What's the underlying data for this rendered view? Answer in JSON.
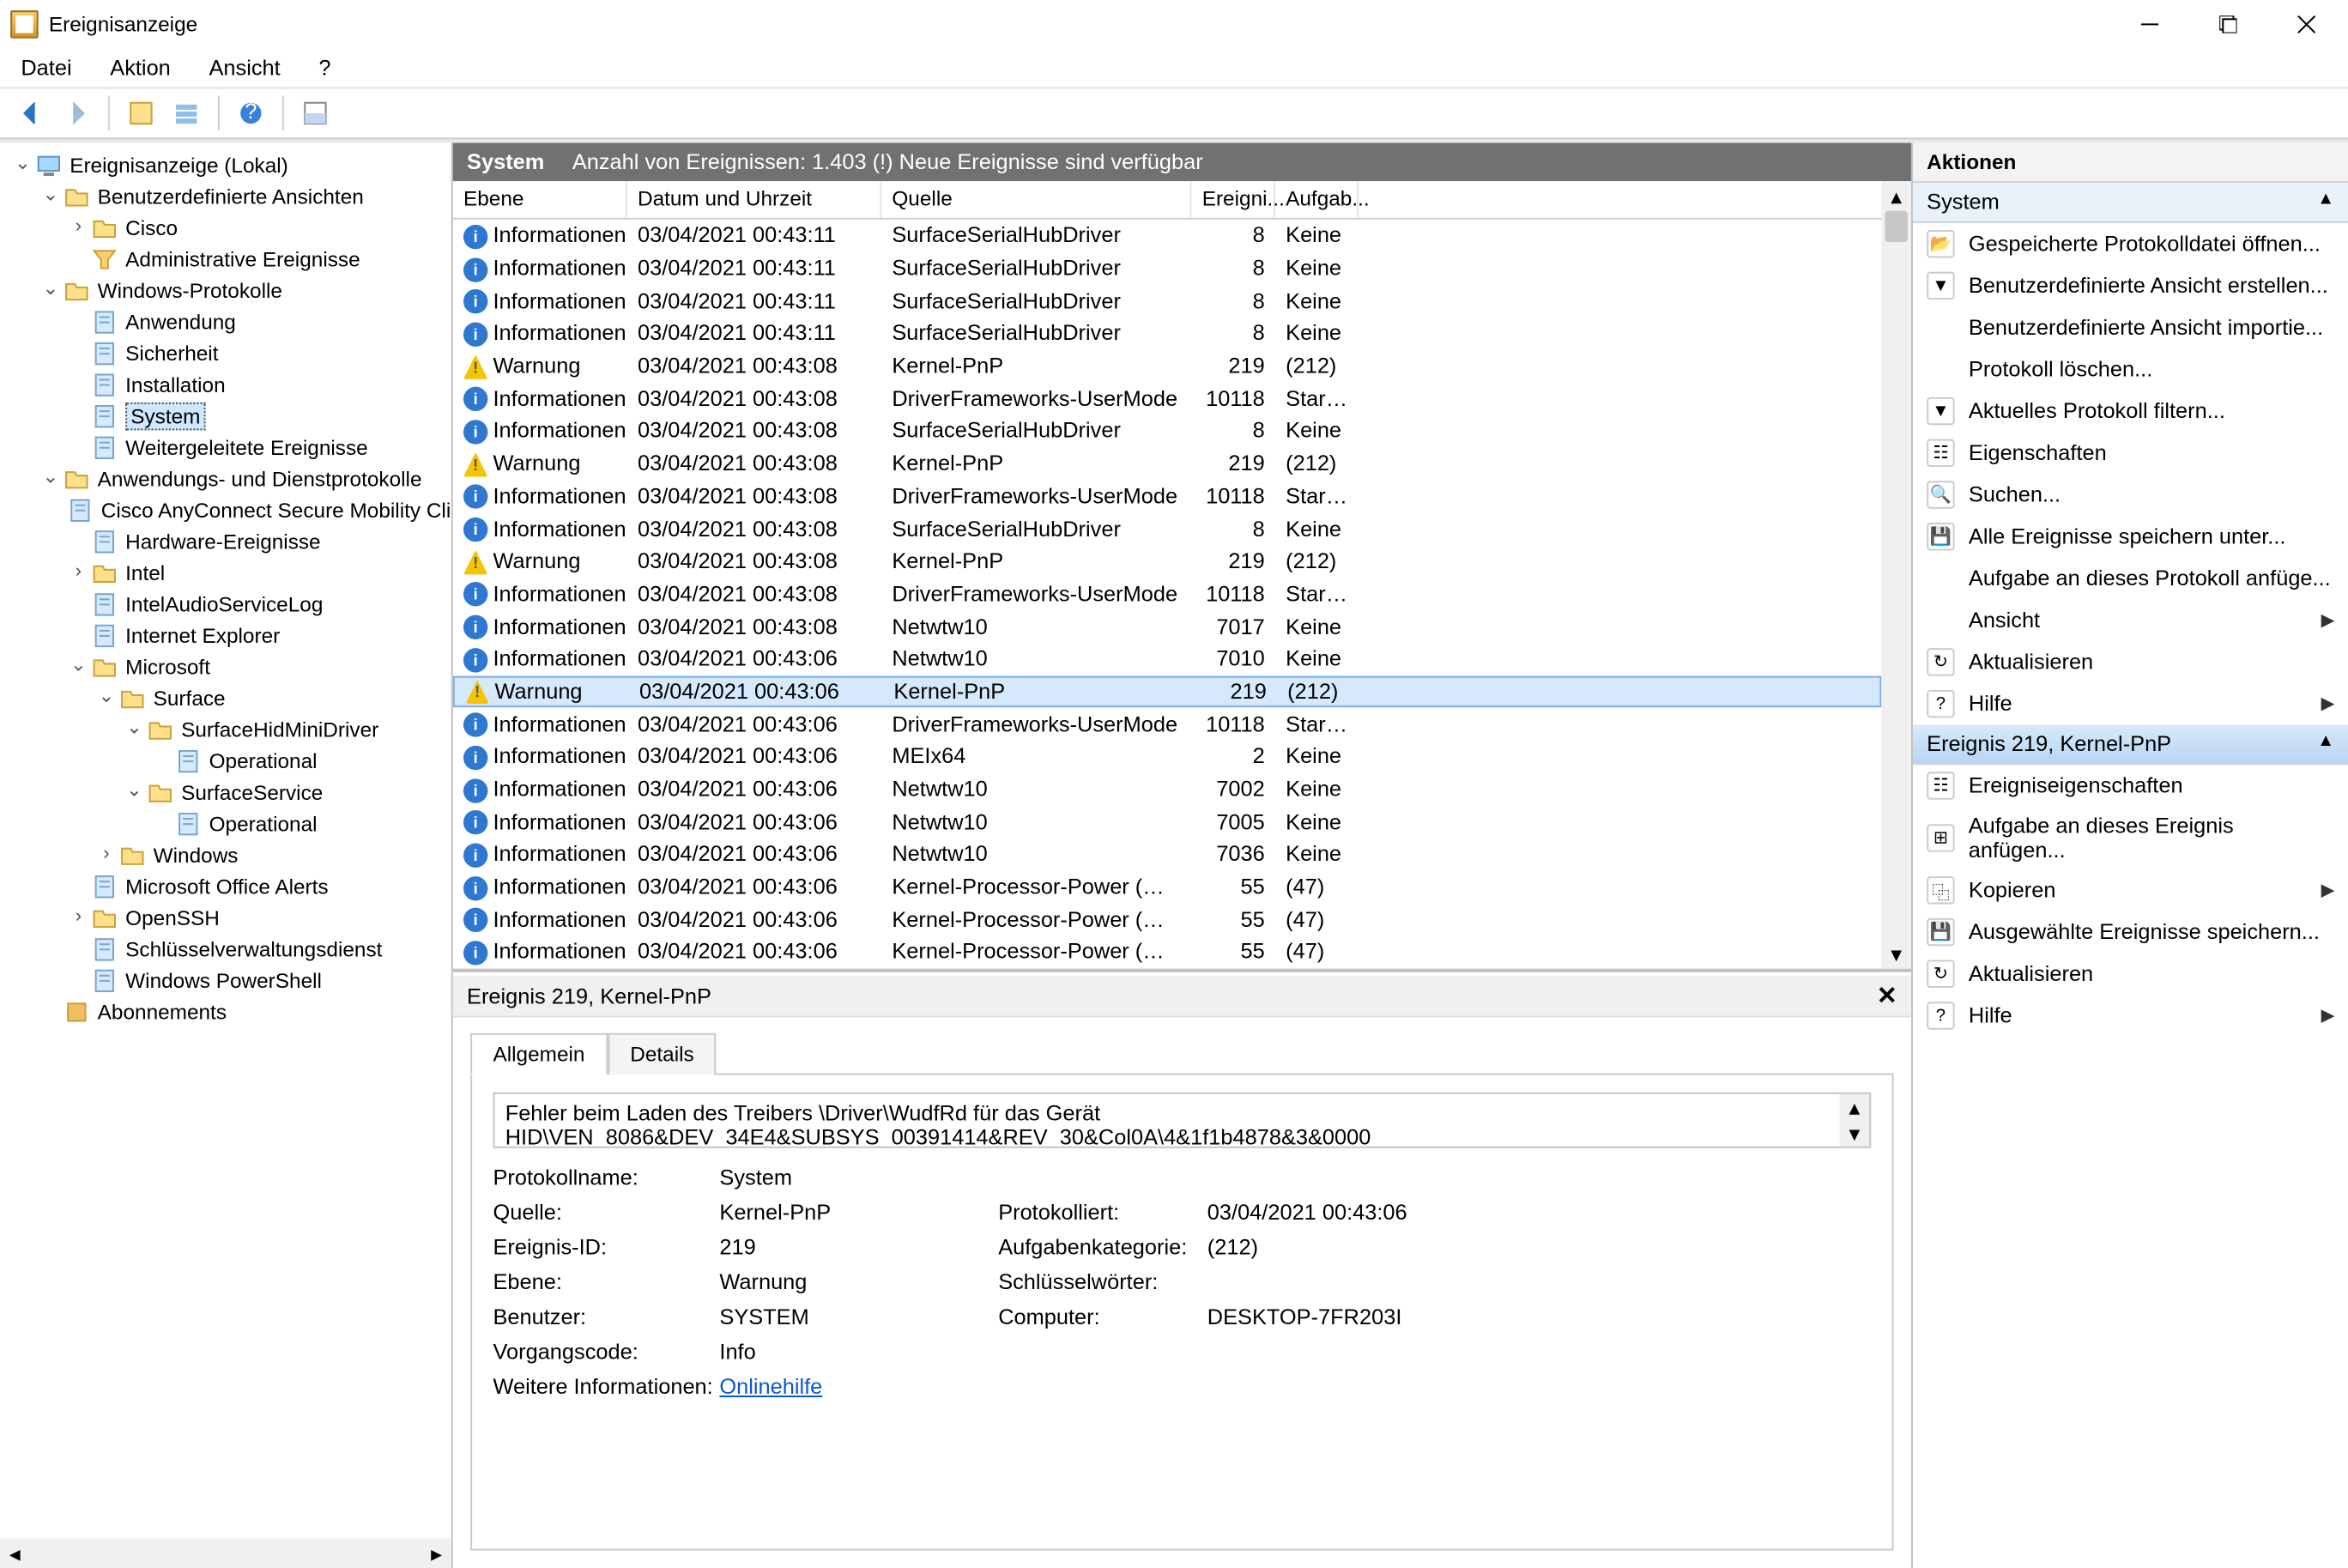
{
  "window": {
    "title": "Ereignisanzeige"
  },
  "menubar": [
    "Datei",
    "Aktion",
    "Ansicht",
    "?"
  ],
  "toolbar_icons": [
    "back-icon",
    "forward-icon",
    "up-level-icon",
    "table-icon",
    "properties-icon",
    "help-icon",
    "preview-icon"
  ],
  "tree": {
    "root": "Ereignisanzeige (Lokal)",
    "items": [
      {
        "depth": 0,
        "tw": "v",
        "icon": "comp",
        "label": "Ereignisanzeige (Lokal)"
      },
      {
        "depth": 1,
        "tw": "v",
        "icon": "folder",
        "label": "Benutzerdefinierte Ansichten"
      },
      {
        "depth": 2,
        "tw": ">",
        "icon": "folder",
        "label": "Cisco"
      },
      {
        "depth": 2,
        "tw": " ",
        "icon": "filter",
        "label": "Administrative Ereignisse"
      },
      {
        "depth": 1,
        "tw": "v",
        "icon": "folder",
        "label": "Windows-Protokolle"
      },
      {
        "depth": 2,
        "tw": " ",
        "icon": "log",
        "label": "Anwendung"
      },
      {
        "depth": 2,
        "tw": " ",
        "icon": "log",
        "label": "Sicherheit"
      },
      {
        "depth": 2,
        "tw": " ",
        "icon": "log",
        "label": "Installation"
      },
      {
        "depth": 2,
        "tw": " ",
        "icon": "log",
        "label": "System",
        "selected": true
      },
      {
        "depth": 2,
        "tw": " ",
        "icon": "log",
        "label": "Weitergeleitete Ereignisse"
      },
      {
        "depth": 1,
        "tw": "v",
        "icon": "folder",
        "label": "Anwendungs- und Dienstprotokolle"
      },
      {
        "depth": 2,
        "tw": " ",
        "icon": "log",
        "label": "Cisco AnyConnect Secure Mobility Clie"
      },
      {
        "depth": 2,
        "tw": " ",
        "icon": "log",
        "label": "Hardware-Ereignisse"
      },
      {
        "depth": 2,
        "tw": ">",
        "icon": "folder",
        "label": "Intel"
      },
      {
        "depth": 2,
        "tw": " ",
        "icon": "log",
        "label": "IntelAudioServiceLog"
      },
      {
        "depth": 2,
        "tw": " ",
        "icon": "log",
        "label": "Internet Explorer"
      },
      {
        "depth": 2,
        "tw": "v",
        "icon": "folder",
        "label": "Microsoft"
      },
      {
        "depth": 3,
        "tw": "v",
        "icon": "folder",
        "label": "Surface"
      },
      {
        "depth": 4,
        "tw": "v",
        "icon": "folder",
        "label": "SurfaceHidMiniDriver"
      },
      {
        "depth": 5,
        "tw": " ",
        "icon": "log",
        "label": "Operational"
      },
      {
        "depth": 4,
        "tw": "v",
        "icon": "folder",
        "label": "SurfaceService"
      },
      {
        "depth": 5,
        "tw": " ",
        "icon": "log",
        "label": "Operational"
      },
      {
        "depth": 3,
        "tw": ">",
        "icon": "folder",
        "label": "Windows"
      },
      {
        "depth": 2,
        "tw": " ",
        "icon": "log",
        "label": "Microsoft Office Alerts"
      },
      {
        "depth": 2,
        "tw": ">",
        "icon": "folder",
        "label": "OpenSSH"
      },
      {
        "depth": 2,
        "tw": " ",
        "icon": "log",
        "label": "Schlüsselverwaltungsdienst"
      },
      {
        "depth": 2,
        "tw": " ",
        "icon": "log",
        "label": "Windows PowerShell"
      },
      {
        "depth": 1,
        "tw": " ",
        "icon": "sub",
        "label": "Abonnements"
      }
    ]
  },
  "grid": {
    "header_name": "System",
    "header_count": "Anzahl von Ereignissen: 1.403 (!) Neue Ereignisse sind verfügbar",
    "columns": [
      "Ebene",
      "Datum und Uhrzeit",
      "Quelle",
      "Ereigni...",
      "Aufgab..."
    ],
    "rows": [
      {
        "lvl": "info",
        "lvlText": "Informationen",
        "dt": "03/04/2021 00:43:11",
        "src": "SurfaceSerialHubDriver",
        "id": "8",
        "task": "Keine"
      },
      {
        "lvl": "info",
        "lvlText": "Informationen",
        "dt": "03/04/2021 00:43:11",
        "src": "SurfaceSerialHubDriver",
        "id": "8",
        "task": "Keine"
      },
      {
        "lvl": "info",
        "lvlText": "Informationen",
        "dt": "03/04/2021 00:43:11",
        "src": "SurfaceSerialHubDriver",
        "id": "8",
        "task": "Keine"
      },
      {
        "lvl": "info",
        "lvlText": "Informationen",
        "dt": "03/04/2021 00:43:11",
        "src": "SurfaceSerialHubDriver",
        "id": "8",
        "task": "Keine"
      },
      {
        "lvl": "warn",
        "lvlText": "Warnung",
        "dt": "03/04/2021 00:43:08",
        "src": "Kernel-PnP",
        "id": "219",
        "task": "(212)"
      },
      {
        "lvl": "info",
        "lvlText": "Informationen",
        "dt": "03/04/2021 00:43:08",
        "src": "DriverFrameworks-UserMode",
        "id": "10118",
        "task": "Startup..."
      },
      {
        "lvl": "info",
        "lvlText": "Informationen",
        "dt": "03/04/2021 00:43:08",
        "src": "SurfaceSerialHubDriver",
        "id": "8",
        "task": "Keine"
      },
      {
        "lvl": "warn",
        "lvlText": "Warnung",
        "dt": "03/04/2021 00:43:08",
        "src": "Kernel-PnP",
        "id": "219",
        "task": "(212)"
      },
      {
        "lvl": "info",
        "lvlText": "Informationen",
        "dt": "03/04/2021 00:43:08",
        "src": "DriverFrameworks-UserMode",
        "id": "10118",
        "task": "Startup..."
      },
      {
        "lvl": "info",
        "lvlText": "Informationen",
        "dt": "03/04/2021 00:43:08",
        "src": "SurfaceSerialHubDriver",
        "id": "8",
        "task": "Keine"
      },
      {
        "lvl": "warn",
        "lvlText": "Warnung",
        "dt": "03/04/2021 00:43:08",
        "src": "Kernel-PnP",
        "id": "219",
        "task": "(212)"
      },
      {
        "lvl": "info",
        "lvlText": "Informationen",
        "dt": "03/04/2021 00:43:08",
        "src": "DriverFrameworks-UserMode",
        "id": "10118",
        "task": "Startup..."
      },
      {
        "lvl": "info",
        "lvlText": "Informationen",
        "dt": "03/04/2021 00:43:08",
        "src": "Netwtw10",
        "id": "7017",
        "task": "Keine"
      },
      {
        "lvl": "info",
        "lvlText": "Informationen",
        "dt": "03/04/2021 00:43:06",
        "src": "Netwtw10",
        "id": "7010",
        "task": "Keine"
      },
      {
        "lvl": "warn",
        "lvlText": "Warnung",
        "dt": "03/04/2021 00:43:06",
        "src": "Kernel-PnP",
        "id": "219",
        "task": "(212)",
        "selected": true
      },
      {
        "lvl": "info",
        "lvlText": "Informationen",
        "dt": "03/04/2021 00:43:06",
        "src": "DriverFrameworks-UserMode",
        "id": "10118",
        "task": "Startup..."
      },
      {
        "lvl": "info",
        "lvlText": "Informationen",
        "dt": "03/04/2021 00:43:06",
        "src": "MEIx64",
        "id": "2",
        "task": "Keine"
      },
      {
        "lvl": "info",
        "lvlText": "Informationen",
        "dt": "03/04/2021 00:43:06",
        "src": "Netwtw10",
        "id": "7002",
        "task": "Keine"
      },
      {
        "lvl": "info",
        "lvlText": "Informationen",
        "dt": "03/04/2021 00:43:06",
        "src": "Netwtw10",
        "id": "7005",
        "task": "Keine"
      },
      {
        "lvl": "info",
        "lvlText": "Informationen",
        "dt": "03/04/2021 00:43:06",
        "src": "Netwtw10",
        "id": "7036",
        "task": "Keine"
      },
      {
        "lvl": "info",
        "lvlText": "Informationen",
        "dt": "03/04/2021 00:43:06",
        "src": "Kernel-Processor-Power (Micr...",
        "id": "55",
        "task": "(47)"
      },
      {
        "lvl": "info",
        "lvlText": "Informationen",
        "dt": "03/04/2021 00:43:06",
        "src": "Kernel-Processor-Power (Micr...",
        "id": "55",
        "task": "(47)"
      },
      {
        "lvl": "info",
        "lvlText": "Informationen",
        "dt": "03/04/2021 00:43:06",
        "src": "Kernel-Processor-Power (Micr...",
        "id": "55",
        "task": "(47)"
      }
    ]
  },
  "detail": {
    "title": "Ereignis 219, Kernel-PnP",
    "tabs": [
      "Allgemein",
      "Details"
    ],
    "description": "Fehler beim Laden des Treibers \\Driver\\WudfRd für das Gerät HID\\VEN_8086&DEV_34E4&SUBSYS_00391414&REV_30&Col0A\\4&1f1b4878&3&0000",
    "props": {
      "Protokollname": "System",
      "Quelle": "Kernel-PnP",
      "Protokolliert": "03/04/2021 00:43:06",
      "EreignisID": "219",
      "Aufgabenkategorie": "(212)",
      "Ebene": "Warnung",
      "Schluesselwoerter": "",
      "Benutzer": "SYSTEM",
      "Computer": "DESKTOP-7FR203I",
      "Vorgangscode": "Info",
      "WeitereInformationen": "Onlinehilfe"
    },
    "labels": {
      "Protokollname": "Protokollname:",
      "Quelle": "Quelle:",
      "Protokolliert": "Protokolliert:",
      "EreignisID": "Ereignis-ID:",
      "Aufgabenkategorie": "Aufgabenkategorie:",
      "Ebene": "Ebene:",
      "Schluesselwoerter": "Schlüsselwörter:",
      "Benutzer": "Benutzer:",
      "Computer": "Computer:",
      "Vorgangscode": "Vorgangscode:",
      "WeitereInformationen": "Weitere Informationen:"
    }
  },
  "actions": {
    "title": "Aktionen",
    "section1": "System",
    "items1": [
      {
        "icon": "open",
        "label": "Gespeicherte Protokolldatei öffnen..."
      },
      {
        "icon": "filter",
        "label": "Benutzerdefinierte Ansicht erstellen..."
      },
      {
        "icon": "",
        "label": "Benutzerdefinierte Ansicht importie..."
      },
      {
        "icon": "",
        "label": "Protokoll löschen..."
      },
      {
        "icon": "funnel",
        "label": "Aktuelles Protokoll filtern..."
      },
      {
        "icon": "props",
        "label": "Eigenschaften"
      },
      {
        "icon": "search",
        "label": "Suchen..."
      },
      {
        "icon": "save",
        "label": "Alle Ereignisse speichern unter..."
      },
      {
        "icon": "",
        "label": "Aufgabe an dieses Protokoll anfüge..."
      },
      {
        "icon": "",
        "label": "Ansicht",
        "sub": true
      },
      {
        "icon": "refresh",
        "label": "Aktualisieren"
      },
      {
        "icon": "help",
        "label": "Hilfe",
        "sub": true
      }
    ],
    "section2": "Ereignis 219, Kernel-PnP",
    "items2": [
      {
        "icon": "props",
        "label": "Ereigniseigenschaften"
      },
      {
        "icon": "task",
        "label": "Aufgabe an dieses Ereignis anfügen..."
      },
      {
        "icon": "copy",
        "label": "Kopieren",
        "sub": true
      },
      {
        "icon": "save",
        "label": "Ausgewählte Ereignisse speichern..."
      },
      {
        "icon": "refresh",
        "label": "Aktualisieren"
      },
      {
        "icon": "help",
        "label": "Hilfe",
        "sub": true
      }
    ]
  }
}
